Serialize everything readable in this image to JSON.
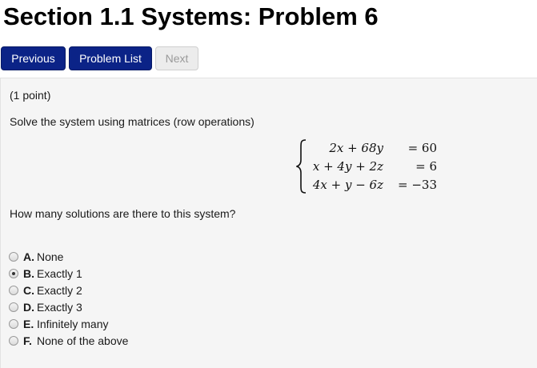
{
  "page": {
    "title": "Section 1.1 Systems: Problem 6"
  },
  "nav": {
    "previous_label": "Previous",
    "problem_list_label": "Problem List",
    "next_label": "Next"
  },
  "problem": {
    "points": "(1 point)",
    "prompt": "Solve the system using matrices (row operations)",
    "equations": [
      {
        "lhs": "2x + 68y",
        "rhs": "= 60"
      },
      {
        "lhs": "x + 4y + 2z",
        "rhs": "= 6"
      },
      {
        "lhs": "4x + y − 6z",
        "rhs": "= −33"
      }
    ],
    "question": "How many solutions are there to this system?",
    "options": [
      {
        "letter": "A.",
        "text": "None",
        "selected": false
      },
      {
        "letter": "B.",
        "text": "Exactly 1",
        "selected": true
      },
      {
        "letter": "C.",
        "text": "Exactly 2",
        "selected": false
      },
      {
        "letter": "D.",
        "text": "Exactly 3",
        "selected": false
      },
      {
        "letter": "E.",
        "text": "Infinitely many",
        "selected": false
      },
      {
        "letter": "F.",
        "text": "None of the above",
        "selected": false
      }
    ]
  },
  "colors": {
    "button_primary": "#0b2387",
    "button_disabled": "#ececec",
    "panel_background": "#f5f5f5"
  },
  "icons": {
    "radio": "radio-button-icon",
    "brace": "left-brace-icon"
  }
}
